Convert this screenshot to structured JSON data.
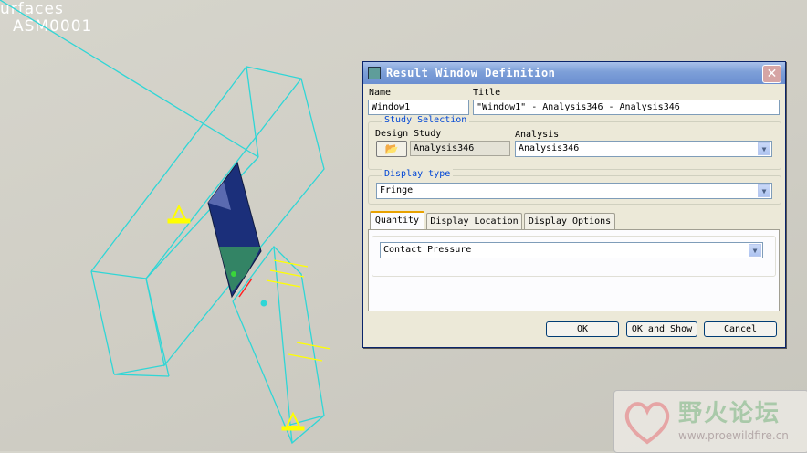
{
  "viewport": {
    "line1": "urfaces",
    "line2": "ASM0001"
  },
  "dialog": {
    "title": "Result Window Definition",
    "close_label": "✕",
    "name_label": "Name",
    "name_value": "Window1",
    "title_label": "Title",
    "title_value": "\"Window1\" - Analysis346 - Analysis346",
    "study_selection_label": "Study Selection",
    "design_study_label": "Design Study",
    "design_study_value": "Analysis346",
    "analysis_label": "Analysis",
    "analysis_value": "Analysis346",
    "display_type_label": "Display type",
    "display_type_value": "Fringe",
    "tabs": [
      {
        "label": "Quantity"
      },
      {
        "label": "Display Location"
      },
      {
        "label": "Display Options"
      }
    ],
    "quantity_value": "Contact Pressure",
    "buttons": {
      "ok": "OK",
      "ok_show": "OK and Show",
      "cancel": "Cancel"
    }
  },
  "watermark": {
    "text": "野火论坛",
    "url": "www.proewildfire.cn"
  },
  "colors": {
    "wireframe": "#2fd6d6",
    "marker": "#ffff00",
    "title_gradient_start": "#a9c1ea",
    "title_gradient_end": "#6b8fd1"
  }
}
